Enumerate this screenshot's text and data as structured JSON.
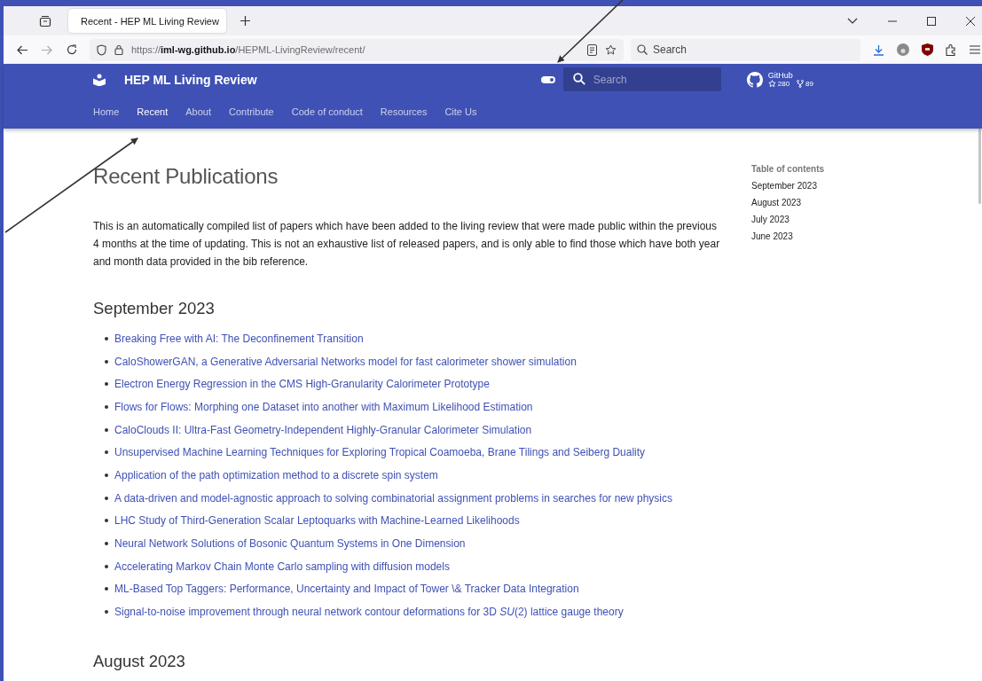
{
  "browser": {
    "tab_title": "Recent - HEP ML Living Review",
    "url": "https://**iml-wg.github.io**/HEPML-LivingReview/recent/",
    "search_placeholder": "Search"
  },
  "site": {
    "title": "HEP ML Living Review",
    "nav": [
      {
        "label": "Home",
        "selected": false
      },
      {
        "label": "Recent",
        "selected": true
      },
      {
        "label": "About",
        "selected": false
      },
      {
        "label": "Contribute",
        "selected": false
      },
      {
        "label": "Code of conduct",
        "selected": false
      },
      {
        "label": "Resources",
        "selected": false
      },
      {
        "label": "Cite Us",
        "selected": false
      }
    ],
    "theme_toggle": {
      "on": true
    },
    "search_placeholder": "Search",
    "github": {
      "label": "GitHub",
      "stars": "280",
      "forks": "89"
    }
  },
  "content": {
    "heading": "Recent Publications",
    "intro": "This is an automatically compiled list of papers which have been added to the living review that were made public within the previous 4 months at the time of updating. This is not an exhaustive list of released papers, and is only able to find those which have both year and month data provided in the bib reference.",
    "sections": [
      {
        "heading": "September 2023",
        "items": [
          "Breaking Free with AI: The Deconfinement Transition",
          "CaloShowerGAN, a Generative Adversarial Networks model for fast calorimeter shower simulation",
          "Electron Energy Regression in the CMS High-Granularity Calorimeter Prototype",
          "Flows for Flows: Morphing one Dataset into another with Maximum Likelihood Estimation",
          "CaloClouds II: Ultra-Fast Geometry-Independent Highly-Granular Calorimeter Simulation",
          "Unsupervised Machine Learning Techniques for Exploring Tropical Coamoeba, Brane Tilings and Seiberg Duality",
          "Application of the path optimization method to a discrete spin system",
          "A data-driven and model-agnostic approach to solving combinatorial assignment problems in searches for new physics",
          "LHC Study of Third-Generation Scalar Leptoquarks with Machine-Learned Likelihoods",
          "Neural Network Solutions of Bosonic Quantum Systems in One Dimension",
          "Accelerating Markov Chain Monte Carlo sampling with diffusion models",
          "ML-Based Top Taggers: Performance, Uncertainty and Impact of Tower \\& Tracker Data Integration",
          "Signal-to-noise improvement through neural network contour deformations for 3D *SU*(2) lattice gauge theory"
        ]
      },
      {
        "heading": "August 2023"
      }
    ]
  },
  "toc": {
    "title": "Table of contents",
    "items": [
      "September 2023",
      "August 2023",
      "July 2023",
      "June 2023"
    ]
  }
}
